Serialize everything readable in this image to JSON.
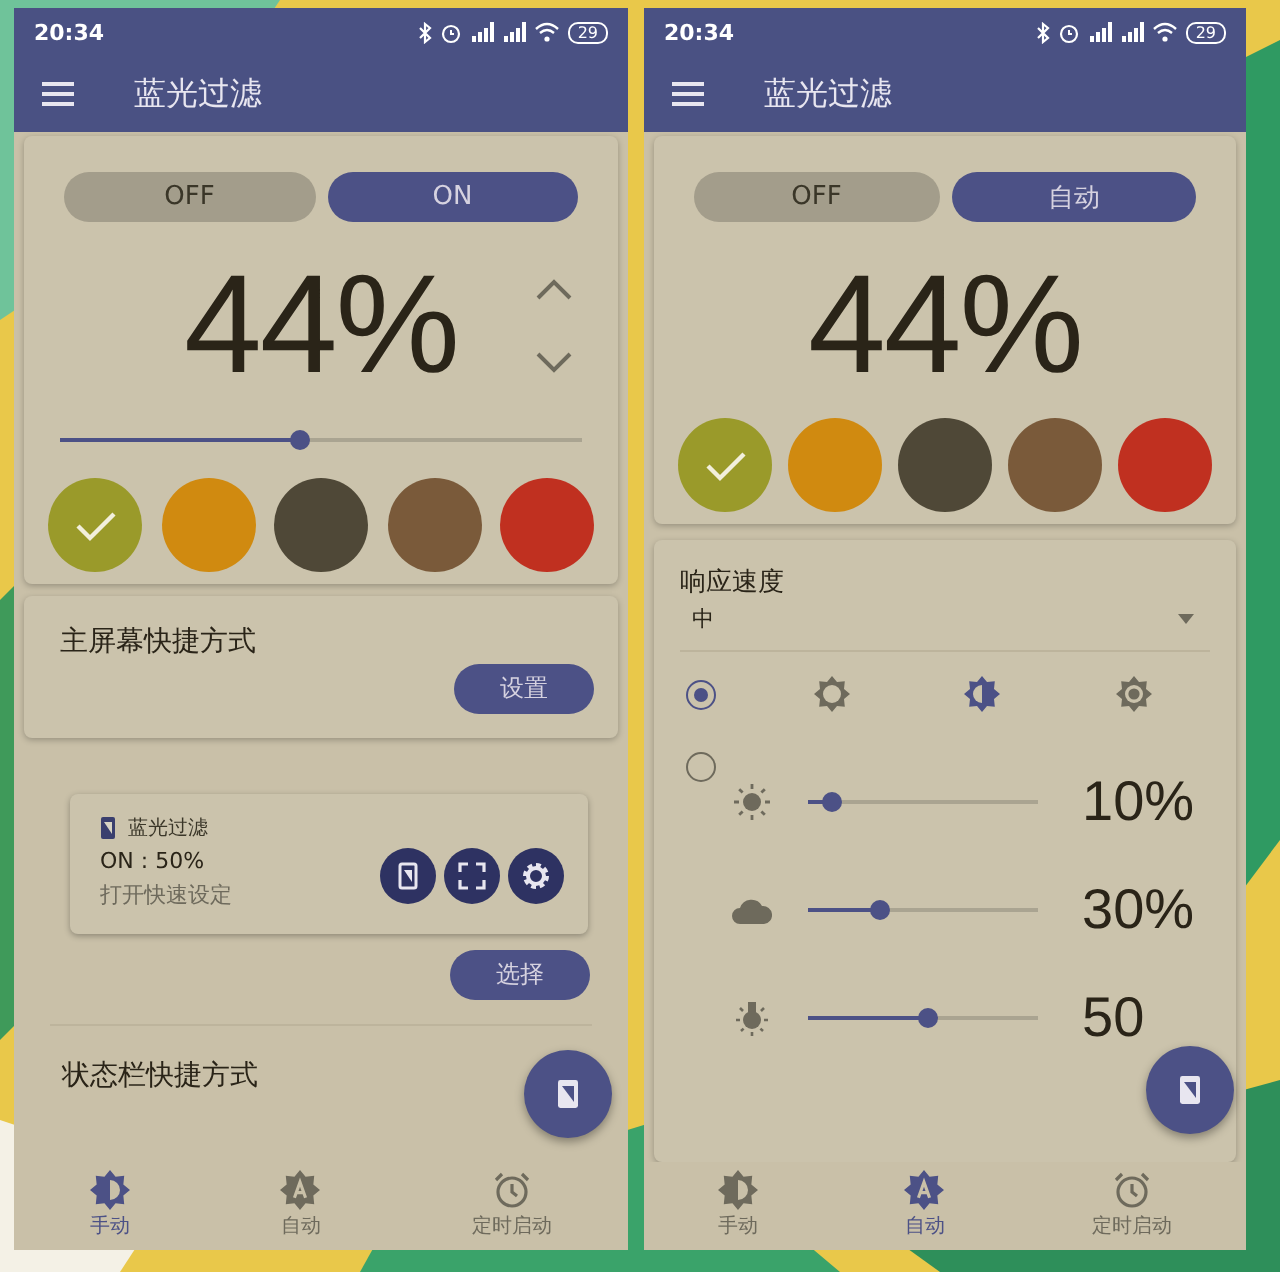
{
  "screens": [
    {
      "status_bar": {
        "time": "20:34",
        "battery": "29"
      },
      "app_bar": {
        "title": "蓝光过滤"
      },
      "mode_buttons": [
        {
          "label": "OFF",
          "selected": false
        },
        {
          "label": "ON",
          "selected": true
        }
      ],
      "percent": "44%",
      "arrows": true,
      "slider": {
        "level": 0.46
      },
      "colors": [
        {
          "color": "#9a9a2a",
          "selected": true
        },
        {
          "color": "#d08a10",
          "selected": false
        },
        {
          "color": "#4f4837",
          "selected": false
        },
        {
          "color": "#7a5a3a",
          "selected": false
        },
        {
          "color": "#c03020",
          "selected": false
        }
      ],
      "home_shortcut": {
        "title": "主屏幕快捷方式",
        "button": "设置"
      },
      "widget_preview": {
        "title": "蓝光过滤",
        "status": "ON : 50%",
        "subtitle": "打开快速设定"
      },
      "select_button": "选择",
      "statusbar_shortcut": {
        "title": "状态栏快捷方式"
      },
      "nav": [
        {
          "kind": "contrast",
          "label": "手动",
          "selected": true
        },
        {
          "kind": "auto",
          "label": "自动",
          "selected": false
        },
        {
          "kind": "alarm",
          "label": "定时启动",
          "selected": false
        }
      ]
    },
    {
      "status_bar": {
        "time": "20:34",
        "battery": "29"
      },
      "app_bar": {
        "title": "蓝光过滤"
      },
      "mode_buttons": [
        {
          "label": "OFF",
          "selected": false
        },
        {
          "label": "自动",
          "selected": true
        }
      ],
      "percent": "44%",
      "colors": [
        {
          "color": "#9a9a2a",
          "selected": true
        },
        {
          "color": "#d08a10",
          "selected": false
        },
        {
          "color": "#4f4837",
          "selected": false
        },
        {
          "color": "#7a5a3a",
          "selected": false
        },
        {
          "color": "#c03020",
          "selected": false
        }
      ],
      "response_speed": {
        "label": "响应速度",
        "value": "中"
      },
      "modes": [
        {
          "selected": true,
          "icons": [
            {
              "kind": "sun",
              "selected": false
            },
            {
              "kind": "contrast",
              "selected": true
            },
            {
              "kind": "gear",
              "selected": false
            }
          ]
        },
        {
          "selected": false,
          "levels": [
            {
              "kind": "sun",
              "level": 0.1,
              "reading": "10%"
            },
            {
              "kind": "cloud",
              "level": 0.31,
              "reading": "30%"
            },
            {
              "kind": "bulb",
              "level": 0.52,
              "reading": "50"
            }
          ]
        }
      ],
      "nav": [
        {
          "kind": "contrast",
          "label": "手动",
          "selected": false
        },
        {
          "kind": "auto",
          "label": "自动",
          "selected": true
        },
        {
          "kind": "alarm",
          "label": "定时启动",
          "selected": false
        }
      ]
    }
  ]
}
